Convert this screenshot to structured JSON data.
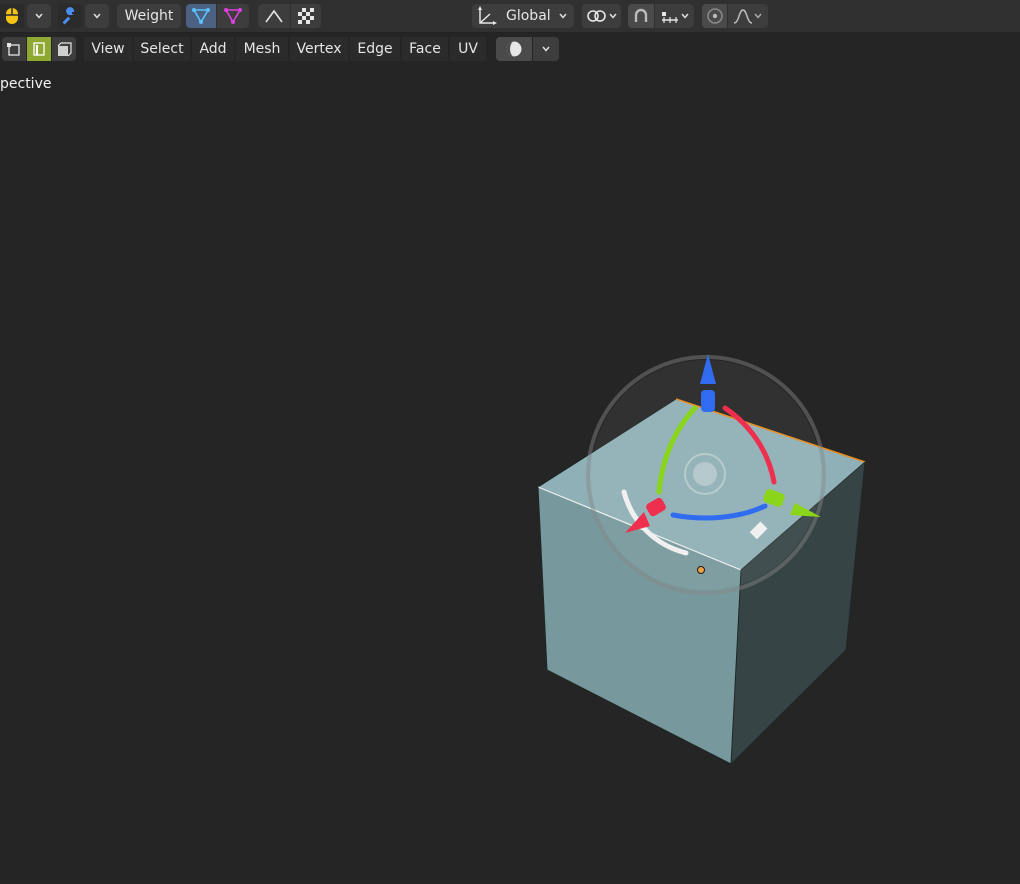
{
  "header": {
    "mode_label": "Weight",
    "orientation_label": "Global"
  },
  "menu": {
    "items": [
      {
        "label": "View"
      },
      {
        "label": "Select"
      },
      {
        "label": "Add"
      },
      {
        "label": "Mesh"
      },
      {
        "label": "Vertex"
      },
      {
        "label": "Edge"
      },
      {
        "label": "Face"
      },
      {
        "label": "UV"
      }
    ]
  },
  "viewport": {
    "view_label": "pective"
  },
  "colors": {
    "x_axis": "#ee2f4d",
    "y_axis": "#8ad41a",
    "z_axis": "#2f6cf0",
    "cube_top": "#8fb0b6",
    "cube_front": "#77989c",
    "cube_side": "#3a4648",
    "header_bg": "#303030",
    "viewport_bg": "#252525"
  }
}
